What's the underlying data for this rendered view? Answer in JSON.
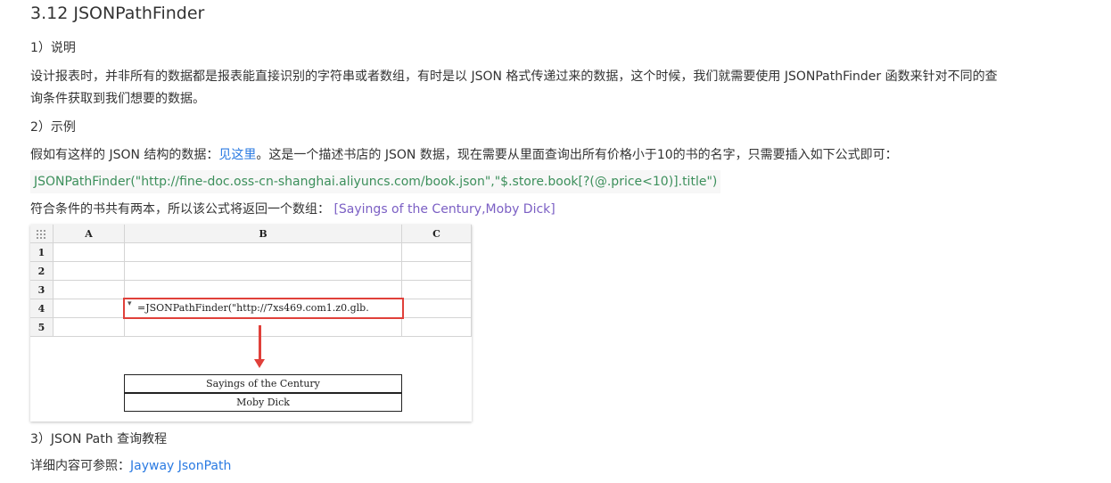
{
  "heading": "3.12 JSONPathFinder",
  "section1": {
    "label": "1）说明"
  },
  "para1": {
    "line1": "设计报表时，并非所有的数据都是报表能直接识别的字符串或者数组，有时是以 JSON 格式传递过来的数据，这个时候，我们就需要使用 JSONPathFinder 函数来针对不同的查",
    "line2": "询条件获取到我们想要的数据。"
  },
  "section2": {
    "label": "2）示例"
  },
  "para2": {
    "before": "假如有这样的 JSON 结构的数据：",
    "link": "见这里",
    "after": "。这是一个描述书店的 JSON 数据，现在需要从里面查询出所有价格小于10的书的名字，只需要插入如下公式即可："
  },
  "code_formula": "JSONPathFinder(\"http://fine-doc.oss-cn-shanghai.aliyuncs.com/book.json\",\"$.store.book[?(@.price<10)].title\")",
  "para3": {
    "before": "符合条件的书共有两本，所以该公式将返回一个数组：",
    "result": "[Sayings of the Century,Moby Dick]"
  },
  "sheet": {
    "corner_icon": "grid-dots",
    "columns": [
      "A",
      "B",
      "C"
    ],
    "rows": [
      "1",
      "2",
      "3",
      "4",
      "5"
    ],
    "formula_text": "=JSONPathFinder(\"http://7xs469.com1.z0.glb.",
    "results": [
      "Sayings of the Century",
      "Moby Dick"
    ],
    "accent": "#e0403a"
  },
  "section3": {
    "label": "3）JSON Path 查询教程"
  },
  "para4": {
    "before": "详细内容可参照：",
    "link": "Jayway JsonPath"
  },
  "colors": {
    "link": "#2a7ae2",
    "code": "#3c8f5b",
    "result": "#7b5fc4"
  }
}
